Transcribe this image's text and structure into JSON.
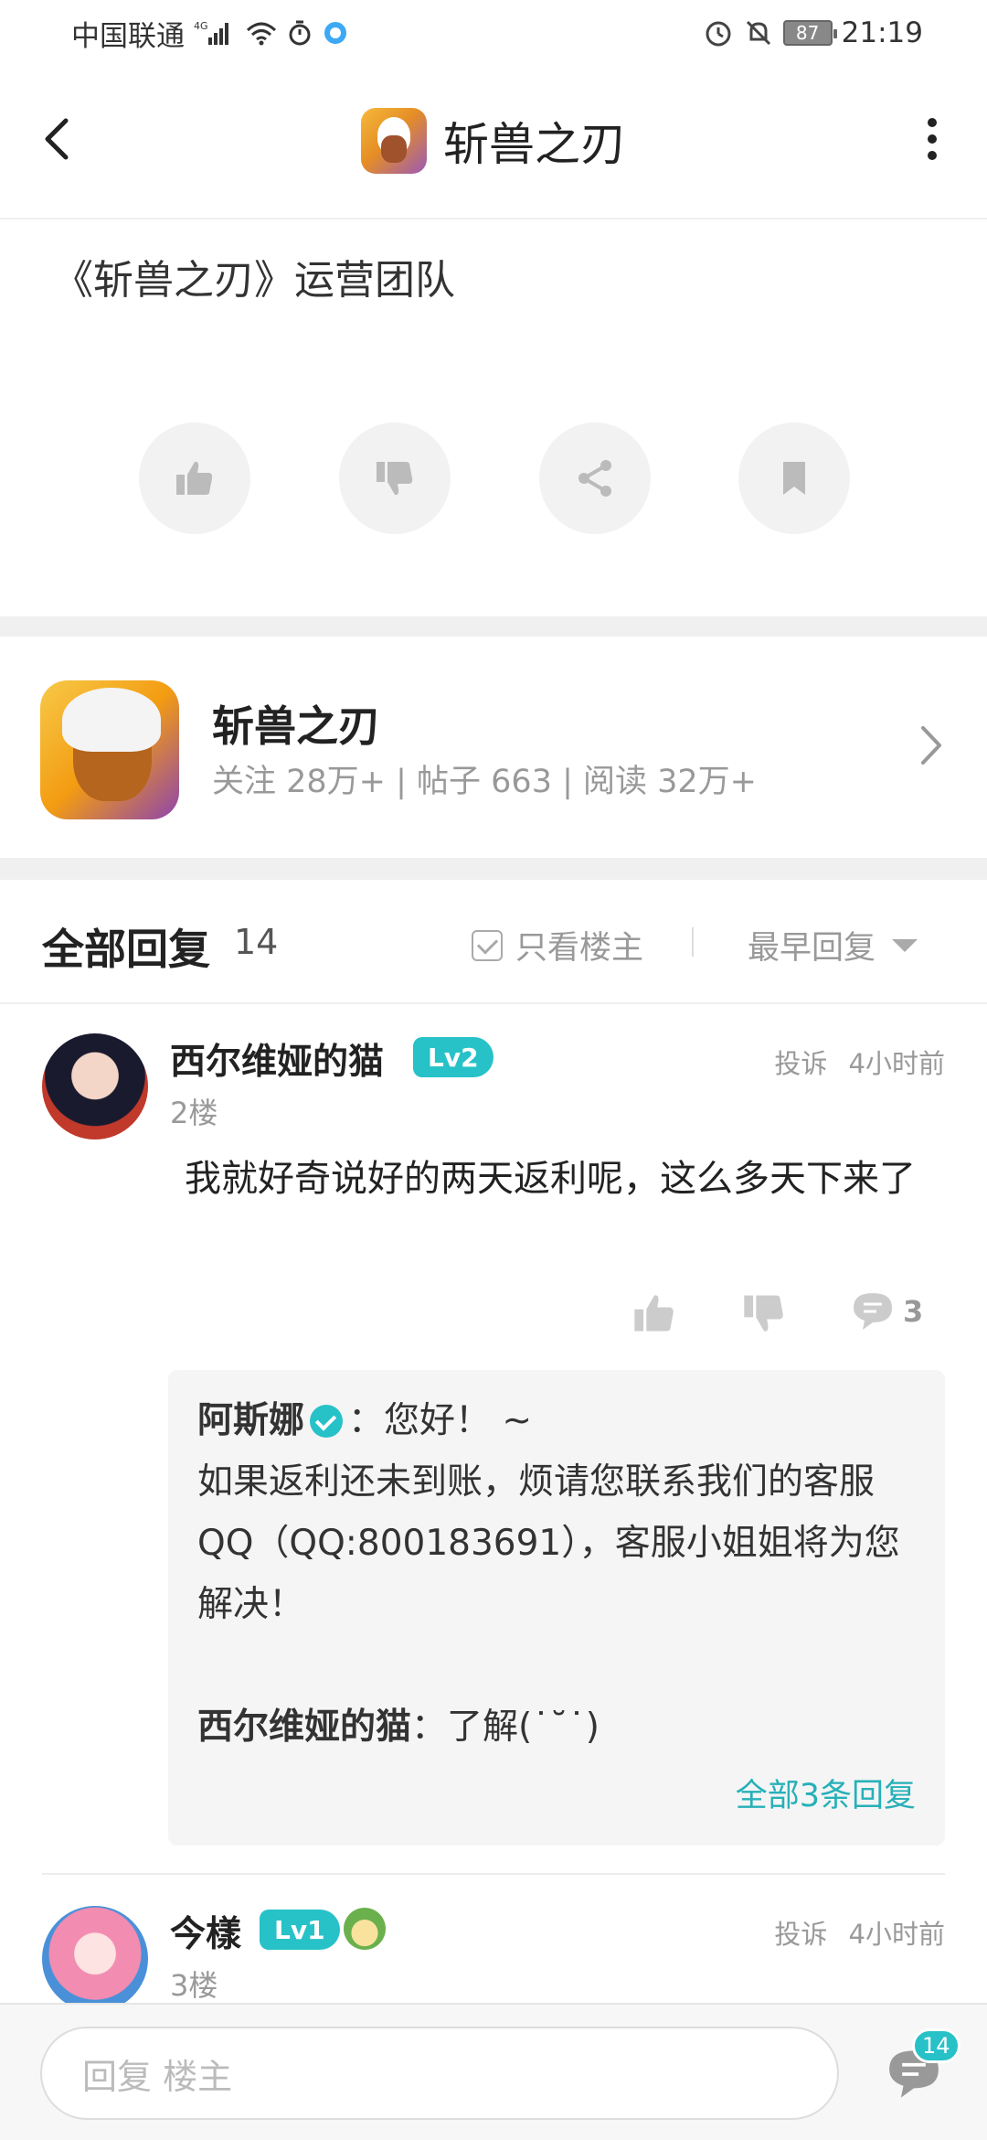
{
  "status_bar": {
    "carrier": "中国联通",
    "network": "4G",
    "battery": "87",
    "time": "21:19"
  },
  "header": {
    "title": "斩兽之刃"
  },
  "post": {
    "text": "《斩兽之刃》运营团队"
  },
  "game_card": {
    "name": "斩兽之刃",
    "stats": "关注 28万+ | 帖子 663 | 阅读 32万+"
  },
  "replies": {
    "title": "全部回复",
    "count": "14",
    "only_op_label": "只看楼主",
    "sort_label": "最早回复"
  },
  "comments": [
    {
      "user": "西尔维娅的猫",
      "level": "Lv2",
      "report": "投诉",
      "time": "4小时前",
      "floor": "2楼",
      "text": "我就好奇说好的两天返利呢，这么多天下来了",
      "reply_count": "3",
      "sub_replies": [
        {
          "user": "阿斯娜",
          "text_first": "：您好！ ~",
          "text_rest": "如果返利还未到账，烦请您联系我们的客服QQ（QQ:800183691），客服小姐姐将为您解决！"
        },
        {
          "user": "西尔维娅的猫",
          "text_first": "：了解(˙˘˙)"
        }
      ],
      "view_all": "全部3条回复"
    },
    {
      "user": "今樣",
      "level": "Lv1",
      "report": "投诉",
      "time": "4小时前",
      "floor": "3楼"
    }
  ],
  "bottom_bar": {
    "placeholder": "回复  楼主",
    "badge": "14"
  },
  "colors": {
    "accent": "#27c1c8",
    "link": "#27b0b8",
    "muted": "#999999",
    "band": "#f0f0f0"
  }
}
